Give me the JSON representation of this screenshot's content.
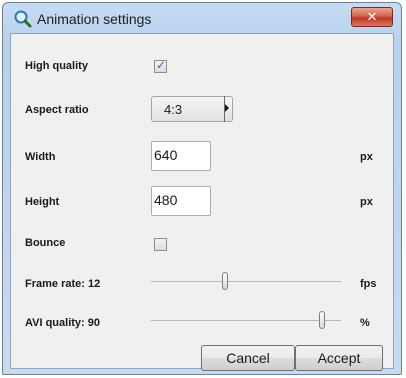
{
  "window": {
    "title": "Animation settings",
    "close_glyph": "✕",
    "icon": "magnifier-icon"
  },
  "form": {
    "high_quality": {
      "label": "High quality",
      "checked": true,
      "check_glyph": "✓"
    },
    "aspect_ratio": {
      "label": "Aspect ratio",
      "value": "4:3"
    },
    "width": {
      "label": "Width",
      "value": "640",
      "unit": "px"
    },
    "height": {
      "label": "Height",
      "value": "480",
      "unit": "px"
    },
    "bounce": {
      "label": "Bounce",
      "checked": false
    },
    "frame_rate": {
      "label": "Frame rate: 12",
      "unit": "fps",
      "position_fraction": 0.39
    },
    "avi_quality": {
      "label": "AVI quality: 90",
      "unit": "%",
      "position_fraction": 0.9
    }
  },
  "buttons": {
    "cancel": "Cancel",
    "accept": "Accept"
  },
  "colors": {
    "close_button": "#c0392b",
    "checkmark": "#3d5ab8",
    "titlebar": "#c5dcf3"
  }
}
